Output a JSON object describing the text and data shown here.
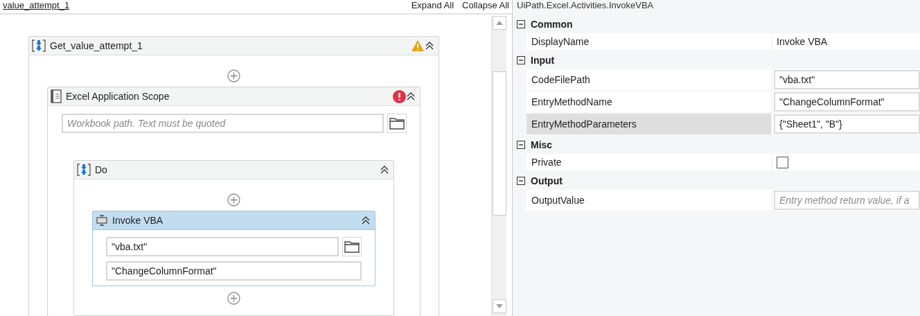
{
  "designer": {
    "breadcrumb": "value_attempt_1",
    "expand_all": "Expand All",
    "collapse_all": "Collapse All",
    "activities": [
      {
        "kind": "sequence",
        "title": "Get_value_attempt_1",
        "warning": true,
        "selected": false,
        "children": [
          {
            "kind": "scope",
            "title": "Excel Application Scope",
            "error": true,
            "selected": false,
            "fields": [
              {
                "placeholder": "Workbook path. Text must be quoted",
                "browse": true
              }
            ],
            "children": [
              {
                "kind": "sequence",
                "title": "Do",
                "selected": false,
                "children": [
                  {
                    "kind": "activity",
                    "title": "Invoke VBA",
                    "selected": true,
                    "fields": [
                      {
                        "value": "\"vba.txt\"",
                        "browse": true
                      },
                      {
                        "value": "\"ChangeColumnFormat\"",
                        "browse": false
                      }
                    ]
                  }
                ]
              }
            ]
          }
        ]
      }
    ]
  },
  "properties": {
    "title": "UiPath.Excel.Activities.InvokeVBA",
    "categories": [
      {
        "name": "Common",
        "expanded": true,
        "rows": [
          {
            "name": "DisplayName",
            "kind": "text",
            "value": "Invoke VBA",
            "selected": false
          }
        ]
      },
      {
        "name": "Input",
        "expanded": true,
        "rows": [
          {
            "name": "CodeFilePath",
            "kind": "field",
            "value": "\"vba.txt\"",
            "selected": false
          },
          {
            "name": "EntryMethodName",
            "kind": "field",
            "value": "\"ChangeColumnFormat\"",
            "selected": false
          },
          {
            "name": "EntryMethodParameters",
            "kind": "field",
            "value": "{\"Sheet1\", \"B\"}",
            "selected": true
          }
        ]
      },
      {
        "name": "Misc",
        "expanded": true,
        "rows": [
          {
            "name": "Private",
            "kind": "checkbox",
            "checked": false,
            "selected": false
          }
        ]
      },
      {
        "name": "Output",
        "expanded": true,
        "rows": [
          {
            "name": "OutputValue",
            "kind": "field",
            "placeholder": "Entry method return value, if a",
            "selected": false
          }
        ]
      }
    ]
  }
}
